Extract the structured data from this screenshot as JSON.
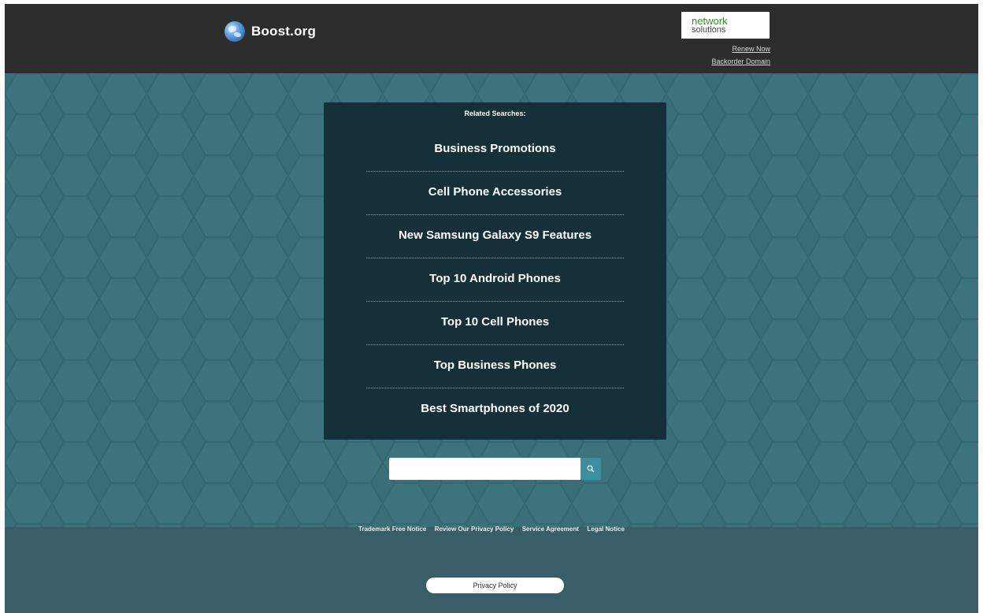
{
  "header": {
    "site_name": "Boost.org",
    "partner_line1": "network",
    "partner_line2": "solutions",
    "renew_link": "Renew Now",
    "backorder_link": "Backorder Domain"
  },
  "related": {
    "title": "Related Searches:",
    "items": [
      "Business Promotions",
      "Cell Phone Accessories",
      "New Samsung Galaxy S9 Features",
      "Top 10 Android Phones",
      "Top 10 Cell Phones",
      "Top Business Phones",
      "Best Smartphones of 2020"
    ]
  },
  "search": {
    "value": "",
    "placeholder": ""
  },
  "footer": {
    "links": [
      "Trademark Free Notice",
      "Review Our Privacy Policy",
      "Service Agreement",
      "Legal Notice"
    ],
    "privacy_button": "Privacy Policy"
  },
  "colors": {
    "topbar": "#2d2d2d",
    "hex_background": "#3a6f79",
    "panel": "#163039",
    "footer": "#3a5e68",
    "search_button": "#3b8fa0"
  },
  "icons": {
    "logo": "globe-icon",
    "search": "search-icon"
  }
}
